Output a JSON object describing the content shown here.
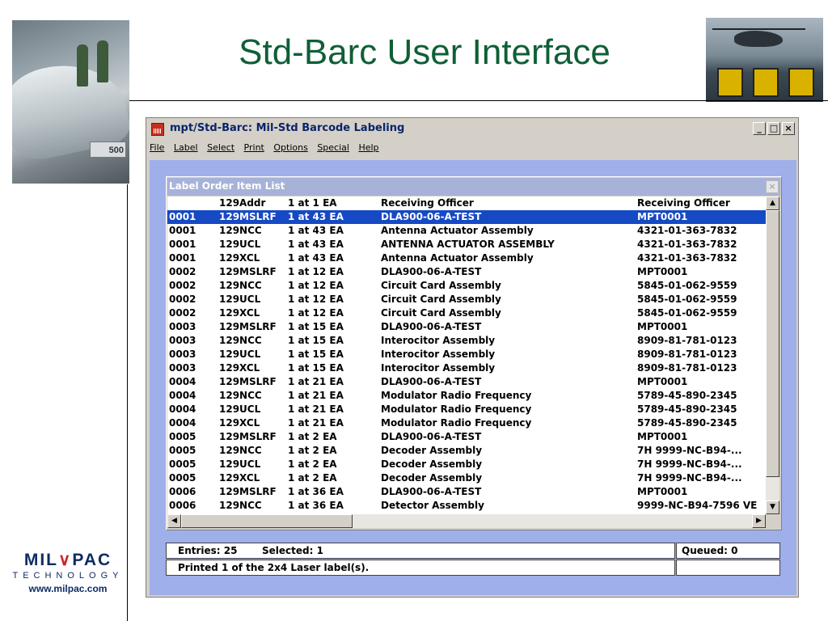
{
  "slide": {
    "title": "Std-Barc User Interface",
    "left_photo_sign": "500",
    "logo": {
      "brand_a": "MIL",
      "brand_mark": "∨",
      "brand_b": "PAC",
      "tagline": "TECHNOLOGY",
      "url": "www.milpac.com"
    }
  },
  "window": {
    "title": "mpt/Std-Barc:  Mil-Std Barcode Labeling",
    "controls": {
      "minimize": "_",
      "maximize": "□",
      "close": "×"
    },
    "menu": [
      "File",
      "Label",
      "Select",
      "Print",
      "Options",
      "Special",
      "Help"
    ]
  },
  "panel": {
    "title": "Label Order Item List",
    "close": "×",
    "header": [
      "",
      "129Addr",
      "1 at 1 EA",
      "Receiving Officer",
      "Receiving Officer"
    ],
    "rows": [
      [
        "0001",
        "129MSLRF",
        "1 at 43 EA",
        "DLA900-06-A-TEST",
        "MPT0001"
      ],
      [
        "0001",
        "129NCC",
        "1 at 43 EA",
        "Antenna Actuator Assembly",
        "4321-01-363-7832"
      ],
      [
        "0001",
        "129UCL",
        "1 at 43 EA",
        "ANTENNA ACTUATOR ASSEMBLY",
        "4321-01-363-7832"
      ],
      [
        "0001",
        "129XCL",
        "1 at 43 EA",
        "Antenna Actuator Assembly",
        "4321-01-363-7832"
      ],
      [
        "0002",
        "129MSLRF",
        "1 at 12 EA",
        "DLA900-06-A-TEST",
        "MPT0001"
      ],
      [
        "0002",
        "129NCC",
        "1 at 12 EA",
        "Circuit Card Assembly",
        "5845-01-062-9559"
      ],
      [
        "0002",
        "129UCL",
        "1 at 12 EA",
        "Circuit Card Assembly",
        "5845-01-062-9559"
      ],
      [
        "0002",
        "129XCL",
        "1 at 12 EA",
        "Circuit Card Assembly",
        "5845-01-062-9559"
      ],
      [
        "0003",
        "129MSLRF",
        "1 at 15 EA",
        "DLA900-06-A-TEST",
        "MPT0001"
      ],
      [
        "0003",
        "129NCC",
        "1 at 15 EA",
        "Interocitor Assembly",
        "8909-81-781-0123"
      ],
      [
        "0003",
        "129UCL",
        "1 at 15 EA",
        "Interocitor Assembly",
        "8909-81-781-0123"
      ],
      [
        "0003",
        "129XCL",
        "1 at 15 EA",
        "Interocitor Assembly",
        "8909-81-781-0123"
      ],
      [
        "0004",
        "129MSLRF",
        "1 at 21 EA",
        "DLA900-06-A-TEST",
        "MPT0001"
      ],
      [
        "0004",
        "129NCC",
        "1 at 21 EA",
        "Modulator Radio Frequency",
        "5789-45-890-2345"
      ],
      [
        "0004",
        "129UCL",
        "1 at 21 EA",
        "Modulator Radio Frequency",
        "5789-45-890-2345"
      ],
      [
        "0004",
        "129XCL",
        "1 at 21 EA",
        "Modulator Radio Frequency",
        "5789-45-890-2345"
      ],
      [
        "0005",
        "129MSLRF",
        "1 at 2 EA",
        "DLA900-06-A-TEST",
        "MPT0001"
      ],
      [
        "0005",
        "129NCC",
        "1 at 2 EA",
        "Decoder Assembly",
        "7H 9999-NC-B94-..."
      ],
      [
        "0005",
        "129UCL",
        "1 at 2 EA",
        "Decoder Assembly",
        "7H 9999-NC-B94-..."
      ],
      [
        "0005",
        "129XCL",
        "1 at 2 EA",
        "Decoder Assembly",
        "7H 9999-NC-B94-..."
      ],
      [
        "0006",
        "129MSLRF",
        "1 at 36 EA",
        "DLA900-06-A-TEST",
        "MPT0001"
      ],
      [
        "0006",
        "129NCC",
        "1 at 36 EA",
        "Detector Assembly",
        "9999-NC-B94-7596 VE"
      ]
    ],
    "selected_row": 0,
    "scroll": {
      "up": "▲",
      "down": "▼",
      "left": "◀",
      "right": "▶"
    }
  },
  "status": {
    "entries": "Entries: 25",
    "selected": "Selected: 1",
    "queued": "Queued: 0",
    "printed": "Printed  1 of the 2x4 Laser label(s)."
  },
  "colors": {
    "title_green": "#0f5f36",
    "selection_blue": "#1649c4",
    "client_bg": "#9eafea",
    "logo_navy": "#0e2c63",
    "logo_red": "#c9292b"
  }
}
